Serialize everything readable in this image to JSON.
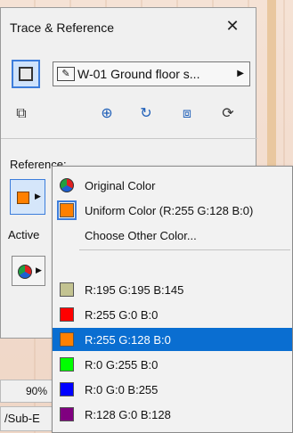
{
  "palette": {
    "title": "Trace & Reference",
    "close_icon": "close-icon",
    "reference_select": "W-01 Ground floor s...",
    "reference_label": "Reference:",
    "active_label": "Active",
    "reference_color": "#ff8000"
  },
  "statusbar": {
    "zoom": "90%",
    "sub": "/Sub-E"
  },
  "menu": {
    "top_items": [
      {
        "label": "Original Color",
        "icon": "multicolor-pie-icon"
      },
      {
        "label": "Uniform Color (R:255 G:128 B:0)",
        "icon": "orange-swatch-icon",
        "color": "#ff8000",
        "checked": true
      },
      {
        "label": "Choose Other Color...",
        "icon": ""
      }
    ],
    "colors": [
      {
        "label": "R:195 G:195 B:145",
        "color": "#c3c391"
      },
      {
        "label": "R:255 G:0 B:0",
        "color": "#ff0000"
      },
      {
        "label": "R:255 G:128 B:0",
        "color": "#ff8000",
        "selected": true
      },
      {
        "label": "R:0 G:255 B:0",
        "color": "#00ff00"
      },
      {
        "label": "R:0 G:0 B:255",
        "color": "#0000ff"
      },
      {
        "label": "R:128 G:0 B:128",
        "color": "#800080"
      }
    ]
  },
  "colors": {
    "accent": "#3c7ddb",
    "selection": "#0a6ed1"
  }
}
